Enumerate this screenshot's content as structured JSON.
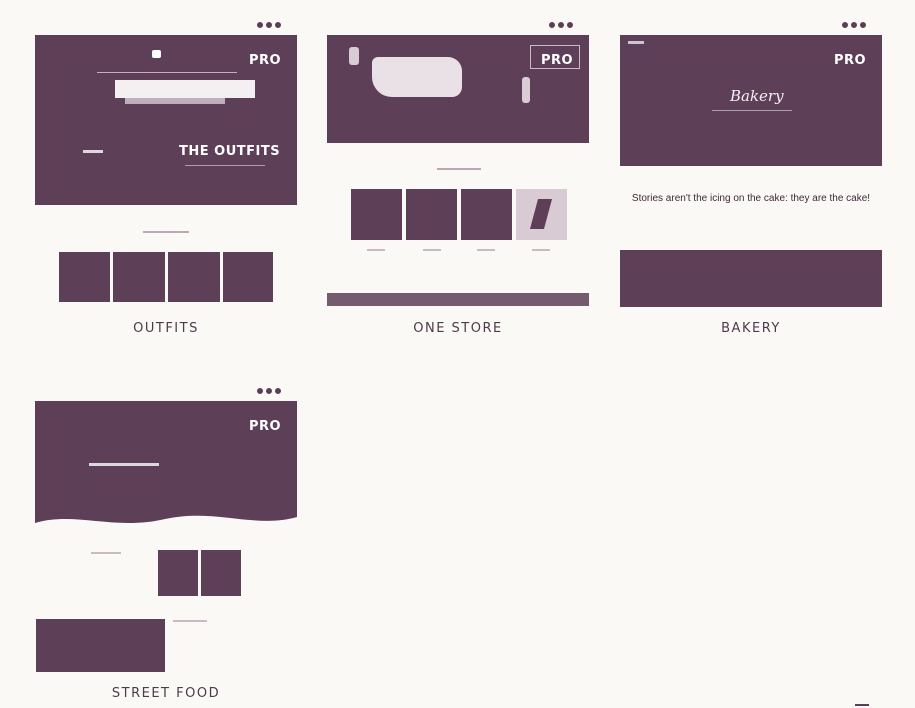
{
  "templates": [
    {
      "id": "outfits",
      "title": "OUTFITS",
      "badge": "PRO",
      "hero_text": "THE OUTFITS"
    },
    {
      "id": "one-store",
      "title": "ONE STORE",
      "badge": "PRO"
    },
    {
      "id": "bakery",
      "title": "BAKERY",
      "badge": "PRO",
      "hero_script": "Bakery",
      "quote": "Stories aren't the icing on the cake: they are the cake!"
    },
    {
      "id": "street-food",
      "title": "STREET FOOD",
      "badge": "PRO"
    }
  ],
  "icons": {
    "window_controls": "three-dots-icon"
  },
  "colors": {
    "brand": "#5d3f58",
    "background": "#fbf9f5",
    "text": "#4e3a4c"
  }
}
